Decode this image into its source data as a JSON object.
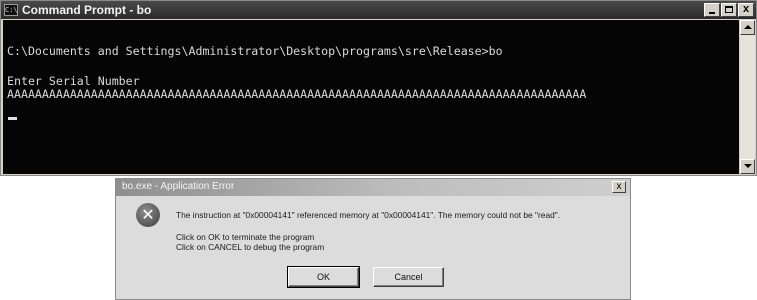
{
  "cmd": {
    "title": "Command Prompt - bo",
    "icon_label": "C:\\",
    "lines": [
      "C:\\Documents and Settings\\Administrator\\Desktop\\programs\\sre\\Release>bo",
      "Enter Serial Number",
      "AAAAAAAAAAAAAAAAAAAAAAAAAAAAAAAAAAAAAAAAAAAAAAAAAAAAAAAAAAAAAAAAAAAAAAAAAAAAAAAAAAA"
    ],
    "controls": {
      "close": "x"
    }
  },
  "dialog": {
    "title": "bo.exe - Application Error",
    "message": "The instruction at \"0x00004141\" referenced memory at \"0x00004141\". The memory could not be \"read\".",
    "hint_ok": "Click on OK to terminate the program",
    "hint_cancel": "Click on CANCEL to debug the program",
    "ok_label": "OK",
    "cancel_label": "Cancel",
    "close": "x",
    "icon": "error-icon"
  }
}
